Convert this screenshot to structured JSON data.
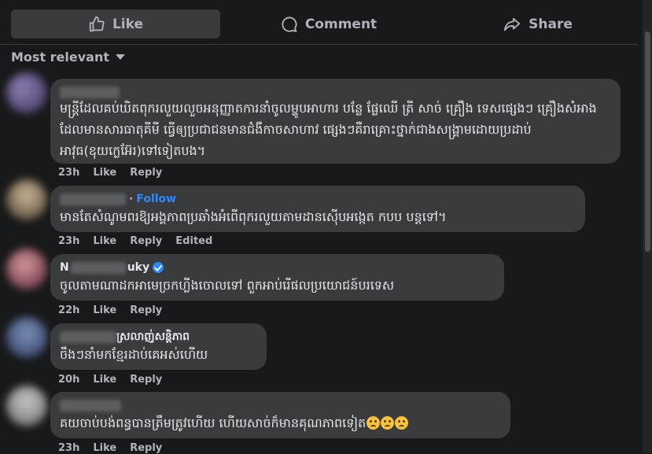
{
  "actions": {
    "like": "Like",
    "comment": "Comment",
    "share": "Share"
  },
  "sort": {
    "label": "Most relevant"
  },
  "comments": [
    {
      "author_suffix": "",
      "text": "មន្ត្រីដែលគប់ឃិតពុករលួយលួចអនុញ្ញាតការនាំចូលម្ហូបអាហារ បន្លែ ផ្លែឈើ ត្រី សាច់ គ្រឿង ទេសផ្សេងៗ គ្រឿងសំអាង ដែលមានសារធាតុគីមី ធ្វើឲ្យប្រជាជនមានជំងឺកាចសាហាវ ផ្សេងៗគឺរាគ្រោះថ្នាក់ជាងសង្គ្រាមដោយប្រដាប់អាវុធ(ឧុយក្លេអ៊ែរ)ទៅទៀតបង។",
      "time": "23h",
      "like": "Like",
      "reply": "Reply",
      "edited": ""
    },
    {
      "author_suffix": "",
      "follow": "Follow",
      "text": "មានតែសំណូមពរឱ្យអង្គភាពប្រឆាំងអំពើពុករលួយតាមដានស៊ើបអង្កេត កបប បន្តទៅ។",
      "time": "23h",
      "like": "Like",
      "reply": "Reply",
      "edited": "Edited"
    },
    {
      "author_prefix": "N",
      "author_suffix": "uky",
      "text": "ចូលតាមណាដកអាមេច្រកហ្លីងចោលទៅ ពួកអាប់រើផលប្រយោជន៍បរទេស",
      "time": "22h",
      "like": "Like",
      "reply": "Reply",
      "edited": ""
    },
    {
      "author_suffix": "ស្រលាញ់សន្តិភាព",
      "text": "ចឹងៗនាំមកខ្មែរដាប់គេអស់ហើយ",
      "time": "20h",
      "like": "Like",
      "reply": "Reply",
      "edited": ""
    },
    {
      "author_suffix": "",
      "text": "គយចាប់បង់ពន្ធបានត្រឹមត្រូវហើយ ហើយសាច់ក៏មានគុណភាពទៀត",
      "time": "23h",
      "like": "Like",
      "reply": "Reply",
      "edited": ""
    }
  ],
  "colors": {
    "background": "#18191a",
    "bubble": "#3a3b3c",
    "accent": "#2d88ff",
    "secondary_text": "#b0b3b8"
  }
}
